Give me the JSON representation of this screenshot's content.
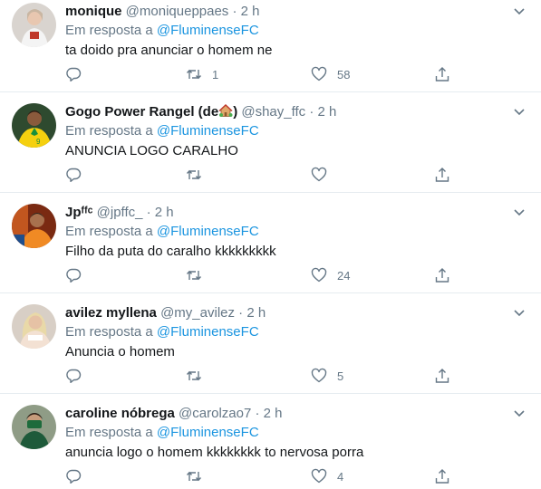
{
  "reply_prefix": "Em resposta a",
  "colors": {
    "link": "#1b95e0",
    "muted": "#657786",
    "text": "#14171a",
    "divider": "#e6ecf0"
  },
  "tweets": [
    {
      "name": "monique",
      "handle": "@moniqueppaes",
      "sep": "·",
      "time": "2 h",
      "reply_to": "@FluminenseFC",
      "text": "ta doido pra anunciar o homem ne",
      "retweets": "1",
      "likes": "58"
    },
    {
      "name": "Gogo Power Rangel (de",
      "name_suffix": ")",
      "name_emoji": "house-emoji",
      "handle": "@shay_ffc",
      "sep": "·",
      "time": "2 h",
      "reply_to": "@FluminenseFC",
      "text": "ANUNCIA LOGO CARALHO",
      "retweets": "",
      "likes": ""
    },
    {
      "name": "Jpᶠᶠᶜ",
      "handle": "@jpffc_",
      "sep": "·",
      "time": "2 h",
      "reply_to": "@FluminenseFC",
      "text": "Filho da puta do caralho kkkkkkkkk",
      "retweets": "",
      "likes": "24"
    },
    {
      "name": "avilez myllena",
      "handle": "@my_avilez",
      "sep": "·",
      "time": "2 h",
      "reply_to": "@FluminenseFC",
      "text": "Anuncia o homem",
      "retweets": "",
      "likes": "5"
    },
    {
      "name": "caroline nóbrega",
      "handle": "@carolzao7",
      "sep": "·",
      "time": "2 h",
      "reply_to": "@FluminenseFC",
      "text": "anuncia logo o homem kkkkkkkk to nervosa porra",
      "retweets": "",
      "likes": "4"
    }
  ]
}
